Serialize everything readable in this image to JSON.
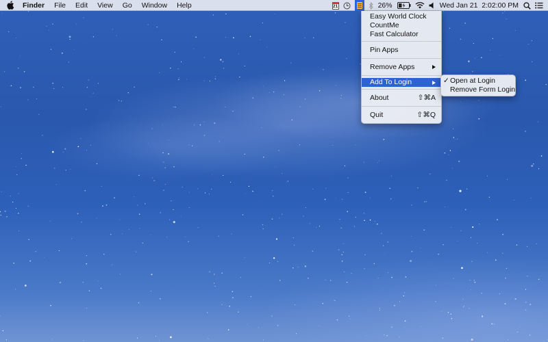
{
  "menubar": {
    "items": [
      {
        "label": "Finder",
        "bold": true
      },
      {
        "label": "File"
      },
      {
        "label": "Edit"
      },
      {
        "label": "View"
      },
      {
        "label": "Go"
      },
      {
        "label": "Window"
      },
      {
        "label": "Help"
      }
    ],
    "calendar_day": "21",
    "battery": "26%",
    "datetime": "Wed Jan 21  2:02:00 PM",
    "icons": [
      "apple-icon",
      "calendar-icon",
      "clock-icon",
      "menu-app-icon",
      "bluetooth-icon",
      "battery-icon",
      "wifi-icon",
      "volume-icon",
      "spotlight-icon",
      "notification-center-icon"
    ]
  },
  "dropdown": {
    "apps": [
      "Easy World Clock",
      "CountMe",
      "Fast Calculator"
    ],
    "pin_apps": "Pin Apps",
    "remove_apps": "Remove Apps",
    "add_to_login": "Add To Login",
    "about": "About",
    "about_shortcut": "⇧⌘A",
    "quit": "Quit",
    "quit_shortcut": "⇧⌘Q"
  },
  "submenu": {
    "open_at_login": "Open at Login",
    "open_at_login_checked": true,
    "check_glyph": "✓",
    "remove_from_login": "Remove Form Login"
  },
  "colors": {
    "highlight": "#2b63d3",
    "desktop": "#2d5db4"
  }
}
